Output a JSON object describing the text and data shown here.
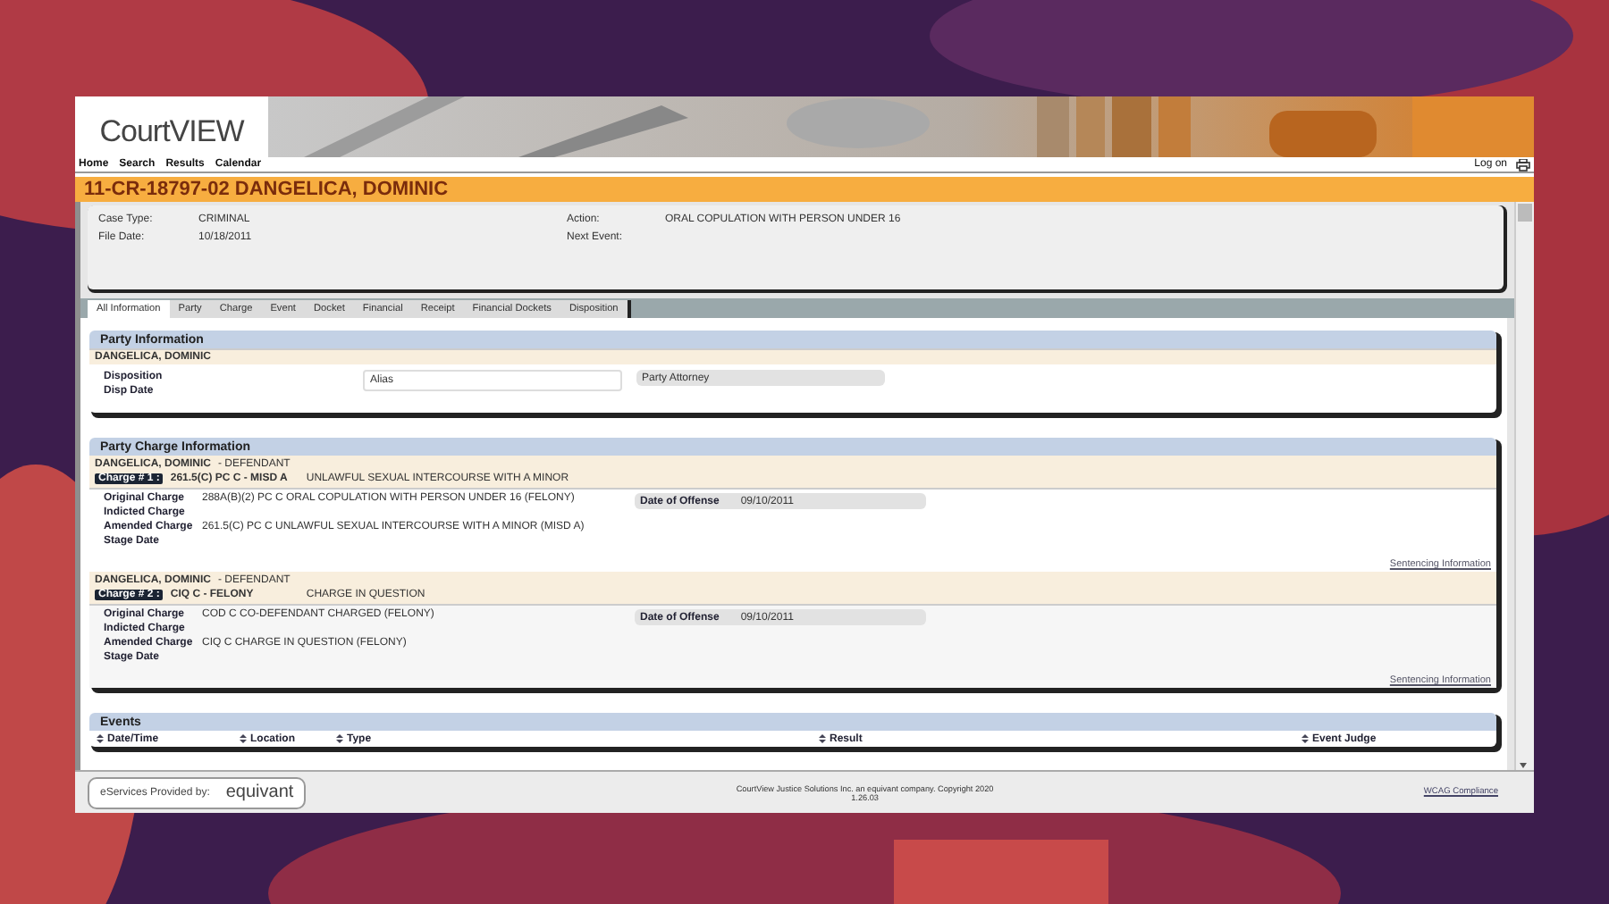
{
  "header": {
    "logo": "CourtVIEW",
    "nav": [
      "Home",
      "Search",
      "Results",
      "Calendar"
    ],
    "log_on": "Log on"
  },
  "case_title": "11-CR-18797-02 DANGELICA, DOMINIC",
  "case_summary": [
    {
      "label": "Case Type:",
      "value": "CRIMINAL"
    },
    {
      "label": "Action:",
      "value": "ORAL COPULATION WITH PERSON UNDER 16"
    },
    {
      "label": "File Date:",
      "value": "10/18/2011"
    },
    {
      "label": "Next Event:"
    }
  ],
  "tabs": [
    {
      "label": "All Information",
      "selected": true
    },
    {
      "label": "Party",
      "selected": false
    },
    {
      "label": "Charge",
      "selected": false
    },
    {
      "label": "Event",
      "selected": false
    },
    {
      "label": "Docket",
      "selected": false
    },
    {
      "label": "Financial",
      "selected": false
    },
    {
      "label": "Receipt",
      "selected": false
    },
    {
      "label": "Financial Dockets",
      "selected": false
    },
    {
      "label": "Disposition",
      "selected": false
    }
  ],
  "party_information": {
    "title": "Party Information",
    "name": "DANGELICA, DOMINIC",
    "labels": [
      "Disposition",
      "Disp Date"
    ],
    "alias_label": "Alias",
    "attorney_label": "Party Attorney"
  },
  "party_charge_information": {
    "title": "Party Charge Information",
    "charges": [
      {
        "party": "DANGELICA, DOMINIC",
        "role": "- DEFENDANT",
        "badge": "Charge # 1 :",
        "code": "261.5(C) PC C - MISD A",
        "description": "UNLAWFUL SEXUAL INTERCOURSE WITH A MINOR",
        "details": [
          {
            "label": "Original Charge",
            "value": "288A(B)(2) PC C ORAL COPULATION WITH PERSON UNDER 16 (FELONY)"
          },
          {
            "label": "Indicted Charge"
          },
          {
            "label": "Amended Charge",
            "value": "261.5(C) PC C UNLAWFUL SEXUAL INTERCOURSE WITH A MINOR (MISD A)"
          },
          {
            "label": "Stage Date"
          }
        ],
        "offense_label": "Date of Offense",
        "offense_date": "09/10/2011",
        "link": "Sentencing Information"
      },
      {
        "party": "DANGELICA, DOMINIC",
        "role": "- DEFENDANT",
        "badge": "Charge # 2 :",
        "code": "CIQ C - FELONY",
        "description": "CHARGE IN QUESTION",
        "details": [
          {
            "label": "Original Charge",
            "value": "COD C CO-DEFENDANT CHARGED (FELONY)"
          },
          {
            "label": "Indicted Charge"
          },
          {
            "label": "Amended Charge",
            "value": "CIQ C CHARGE IN QUESTION (FELONY)"
          },
          {
            "label": "Stage Date"
          }
        ],
        "offense_label": "Date of Offense",
        "offense_date": "09/10/2011",
        "link": "Sentencing Information"
      }
    ]
  },
  "events": {
    "title": "Events",
    "columns": [
      "Date/Time",
      "Location",
      "Type",
      "Result",
      "Event Judge"
    ]
  },
  "footer": {
    "provided_by": "eServices Provided by:",
    "brand": "equivant",
    "copyright": "CourtView Justice Solutions Inc. an equivant company. Copyright 2020",
    "version": "1.26.03",
    "link": "WCAG Compliance"
  }
}
